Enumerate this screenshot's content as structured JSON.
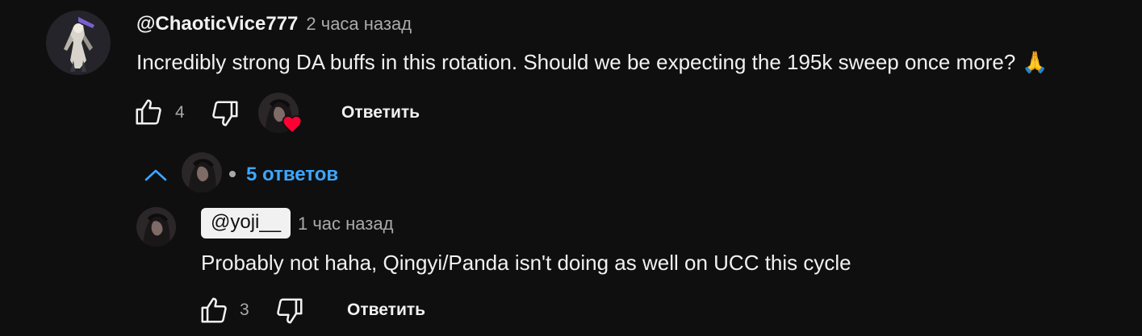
{
  "comment": {
    "author": "@ChaoticVice777",
    "timestamp": "2 часа назад",
    "text": "Incredibly strong DA buffs in this rotation. Should we be expecting the 195k sweep once more?",
    "emoji": "🙏",
    "like_count": "4",
    "reply_label": "Ответить",
    "icons": {
      "like": "thumbs-up-icon",
      "dislike": "thumbs-down-icon",
      "creator_heart": "heart-icon",
      "collapse": "chevron-up-icon"
    }
  },
  "replies": {
    "toggle_label": "5 ответов"
  },
  "reply": {
    "author": "@yoji__",
    "timestamp": "1 час назад",
    "text": "Probably not haha, Qingyi/Panda isn't doing as well on UCC this cycle",
    "like_count": "3",
    "reply_label": "Ответить"
  },
  "colors": {
    "background": "#0f0f0f",
    "text_primary": "#f1f1f1",
    "text_secondary": "#aaaaaa",
    "link_blue": "#3ea6ff",
    "heart_red": "#ff0033"
  }
}
